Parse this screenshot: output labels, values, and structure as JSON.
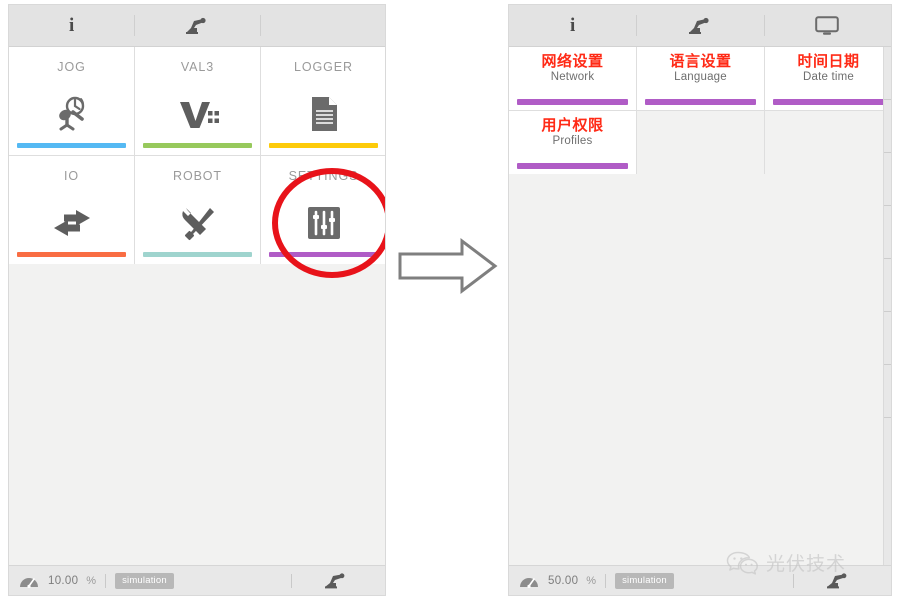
{
  "left_panel": {
    "toolbar": [
      {
        "icon": "info-icon",
        "label": "i"
      },
      {
        "icon": "robot-arm-icon",
        "label": ""
      },
      {
        "icon": "empty-slot",
        "label": ""
      }
    ],
    "tiles": [
      {
        "label": "JOG",
        "icon": "joystick-icon",
        "color": "#55b9f3"
      },
      {
        "label": "VAL3",
        "icon": "val3-v-icon",
        "color": "#97c95c"
      },
      {
        "label": "LOGGER",
        "icon": "document-icon",
        "color": "#fdcb0a"
      },
      {
        "label": "IO",
        "icon": "io-arrows-icon",
        "color": "#f96d43"
      },
      {
        "label": "ROBOT",
        "icon": "tools-icon",
        "color": "#9fd4ce"
      },
      {
        "label": "SETTINGS",
        "icon": "sliders-icon",
        "color": "#b05cc6"
      }
    ],
    "status": {
      "speed": "10.00",
      "percent": "%",
      "badge": "simulation",
      "mode_icon": "robot-arm-icon",
      "gauge_icon": "speed-gauge-icon"
    }
  },
  "right_panel": {
    "toolbar": [
      {
        "icon": "info-icon",
        "label": "i"
      },
      {
        "icon": "robot-arm-icon",
        "label": ""
      },
      {
        "icon": "monitor-icon",
        "label": ""
      }
    ],
    "tiles": [
      {
        "cn": "网络设置",
        "en": "Network",
        "color": "#b05cc6"
      },
      {
        "cn": "语言设置",
        "en": "Language",
        "color": "#b05cc6"
      },
      {
        "cn": "时间日期",
        "en": "Date time",
        "color": "#b05cc6"
      },
      {
        "cn": "用户权限",
        "en": "Profiles",
        "color": "#b05cc6"
      }
    ],
    "status": {
      "speed": "50.00",
      "percent": "%",
      "badge": "simulation",
      "mode_icon": "robot-arm-icon",
      "gauge_icon": "speed-gauge-icon"
    }
  },
  "annotations": {
    "highlight_target": "SETTINGS",
    "highlight_color": "#e8131a",
    "arrow_direction": "right",
    "arrow_color": "#7f7f7f"
  },
  "watermark": {
    "text": "光伏技术",
    "icon": "wechat-icon"
  }
}
